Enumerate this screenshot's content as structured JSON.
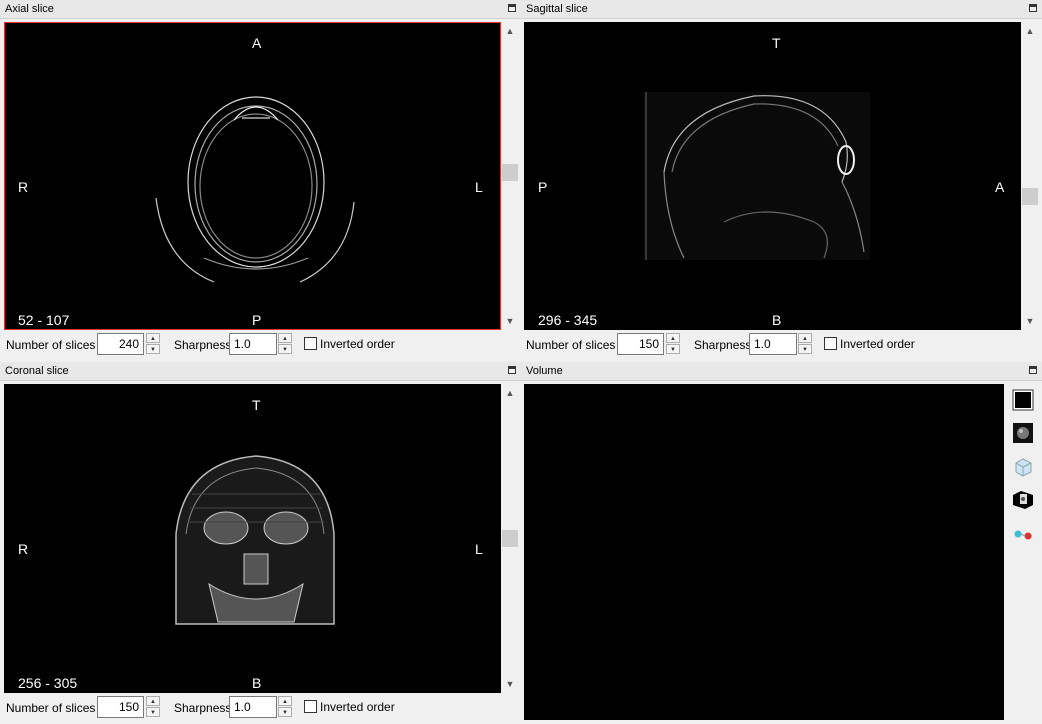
{
  "panes": {
    "axial": {
      "title": "Axial slice",
      "orientation": {
        "top": "A",
        "bottom": "P",
        "left": "R",
        "right": "L"
      },
      "range": "52 - 107",
      "controls": {
        "slices_label": "Number of slices",
        "slices_value": "240",
        "sharpness_label": "Sharpness",
        "sharpness_value": "1.0",
        "inverted_label": "Inverted order",
        "inverted_checked": false
      }
    },
    "sagittal": {
      "title": "Sagittal slice",
      "orientation": {
        "top": "T",
        "bottom": "B",
        "left": "P",
        "right": "A"
      },
      "range": "296 - 345",
      "controls": {
        "slices_label": "Number of slices",
        "slices_value": "150",
        "sharpness_label": "Sharpness",
        "sharpness_value": "1.0",
        "inverted_label": "Inverted order",
        "inverted_checked": false
      }
    },
    "coronal": {
      "title": "Coronal slice",
      "orientation": {
        "top": "T",
        "bottom": "B",
        "left": "R",
        "right": "L"
      },
      "range": "256 - 305",
      "controls": {
        "slices_label": "Number of slices",
        "slices_value": "150",
        "sharpness_label": "Sharpness",
        "sharpness_value": "1.0",
        "inverted_label": "Inverted order",
        "inverted_checked": false
      }
    },
    "volume": {
      "title": "Volume",
      "toolbar": [
        "background-color-icon",
        "volume-render-icon",
        "bounding-box-icon",
        "slice-planes-icon",
        "stereo-glasses-icon"
      ]
    }
  },
  "colors": {
    "active_border": "#dd3333",
    "viewport_bg": "#000000",
    "panel_bg": "#f0f0f0"
  }
}
